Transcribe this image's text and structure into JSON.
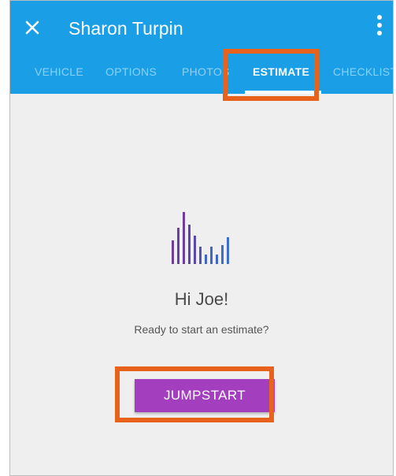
{
  "appbar": {
    "title": "Sharon Turpin",
    "close_icon": "close-icon",
    "menu_icon": "more-vert-icon",
    "color": "#1a9fe6"
  },
  "tabs": [
    {
      "label": "VEHICLE",
      "active": false
    },
    {
      "label": "OPTIONS",
      "active": false
    },
    {
      "label": "PHOTOS",
      "active": false
    },
    {
      "label": "ESTIMATE",
      "active": true
    },
    {
      "label": "CHECKLIST",
      "active": false
    }
  ],
  "main": {
    "logo_icon": "equalizer-bars-icon",
    "greeting": "Hi Joe!",
    "subtext": "Ready to start an estimate?",
    "button_label": "JUMPSTART",
    "button_color": "#a33fbf"
  },
  "highlight_color": "#e8621c"
}
